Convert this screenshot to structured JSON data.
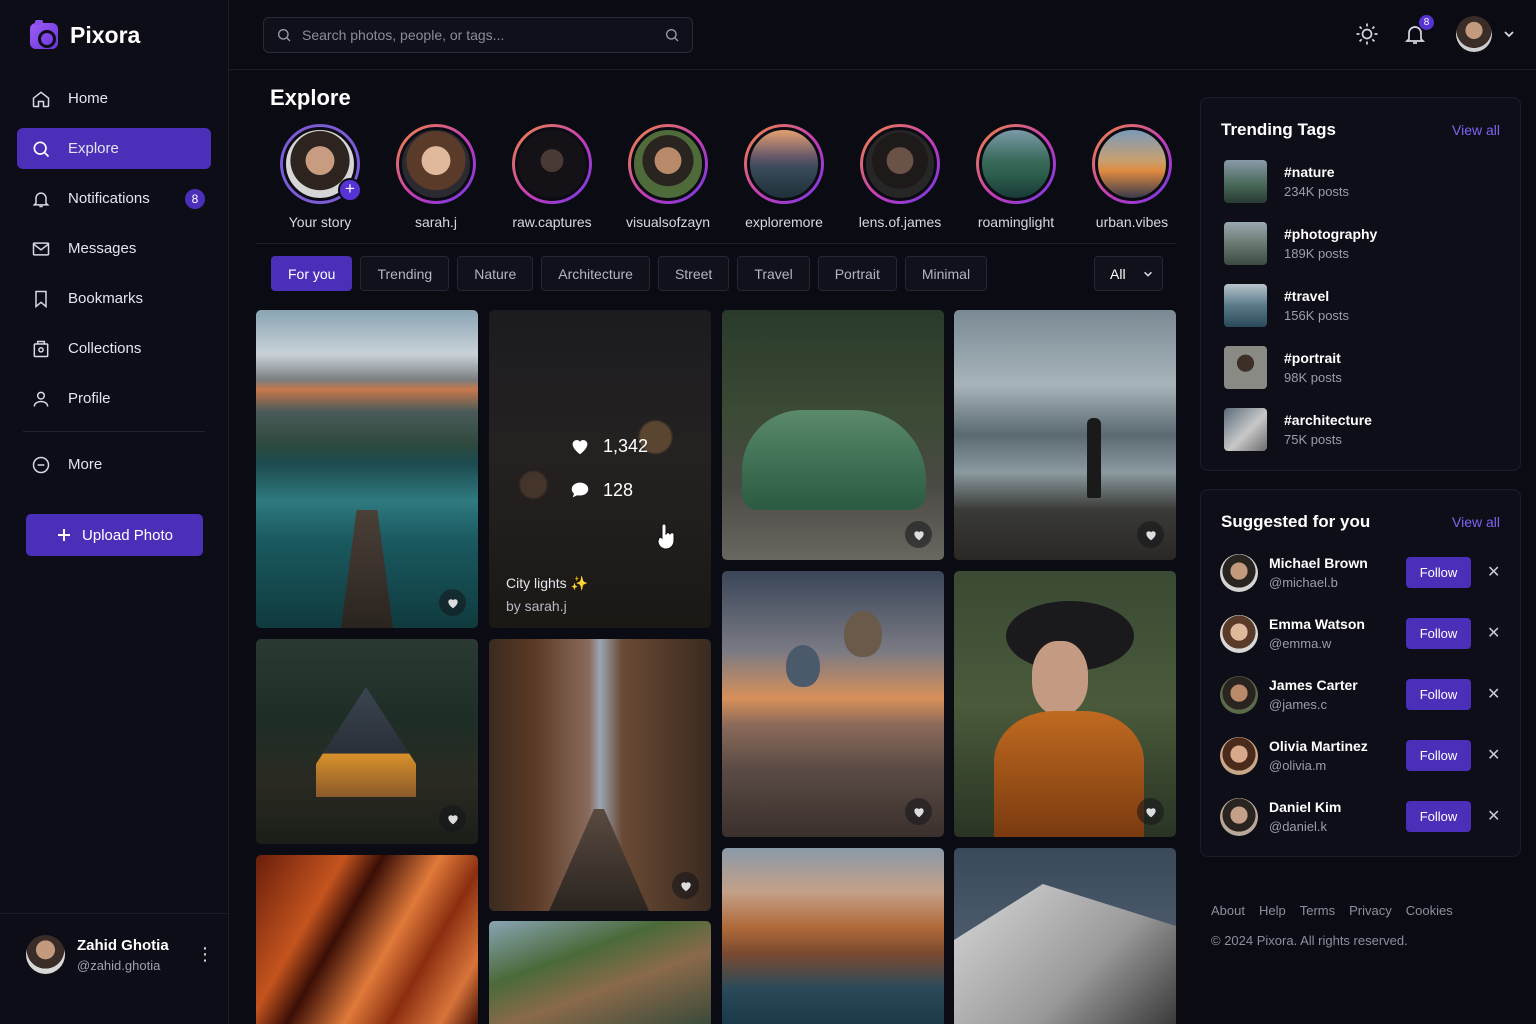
{
  "app": {
    "name": "Pixora"
  },
  "sidebar": {
    "items": [
      {
        "label": "Home",
        "icon": "home-icon"
      },
      {
        "label": "Explore",
        "icon": "search-icon",
        "active": true
      },
      {
        "label": "Notifications",
        "icon": "bell-icon",
        "badge": "8"
      },
      {
        "label": "Messages",
        "icon": "mail-icon"
      },
      {
        "label": "Bookmarks",
        "icon": "bookmark-icon"
      },
      {
        "label": "Collections",
        "icon": "collections-icon"
      },
      {
        "label": "Profile",
        "icon": "user-icon"
      }
    ],
    "more_label": "More",
    "upload_label": "Upload Photo",
    "user": {
      "name": "Zahid Ghotia",
      "handle": "@zahid.ghotia"
    }
  },
  "topbar": {
    "search_placeholder": "Search photos, people, or tags...",
    "notification_count": "8"
  },
  "explore": {
    "title": "Explore",
    "stories": [
      {
        "label": "Your story",
        "own": true
      },
      {
        "label": "sarah.j"
      },
      {
        "label": "raw.captures"
      },
      {
        "label": "visualsofzayn"
      },
      {
        "label": "exploremore"
      },
      {
        "label": "lens.of.james"
      },
      {
        "label": "roaminglight"
      },
      {
        "label": "urban.vibes"
      }
    ],
    "filters": [
      "For you",
      "Trending",
      "Nature",
      "Architecture",
      "Street",
      "Travel",
      "Portrait",
      "Minimal"
    ],
    "active_filter": "For you",
    "sort_value": "All",
    "hover_card": {
      "likes": "1,342",
      "comments": "128",
      "caption": "City lights ✨",
      "byline": "by sarah.j"
    }
  },
  "trending": {
    "title": "Trending Tags",
    "view_all": "View all",
    "tags": [
      {
        "name": "#nature",
        "count": "234K posts"
      },
      {
        "name": "#photography",
        "count": "189K posts"
      },
      {
        "name": "#travel",
        "count": "156K posts"
      },
      {
        "name": "#portrait",
        "count": "98K posts"
      },
      {
        "name": "#architecture",
        "count": "75K posts"
      }
    ]
  },
  "suggested": {
    "title": "Suggested for you",
    "view_all": "View all",
    "follow_label": "Follow",
    "users": [
      {
        "name": "Michael Brown",
        "handle": "@michael.b"
      },
      {
        "name": "Emma Watson",
        "handle": "@emma.w"
      },
      {
        "name": "James Carter",
        "handle": "@james.c"
      },
      {
        "name": "Olivia Martinez",
        "handle": "@olivia.m"
      },
      {
        "name": "Daniel Kim",
        "handle": "@daniel.k"
      }
    ]
  },
  "footer": {
    "links": [
      "About",
      "Help",
      "Terms",
      "Privacy",
      "Cookies"
    ],
    "copyright": "© 2024 Pixora. All rights reserved."
  },
  "colors": {
    "accent": "#4b2fb8",
    "background": "#0b0b14",
    "link": "#7d63f2"
  }
}
